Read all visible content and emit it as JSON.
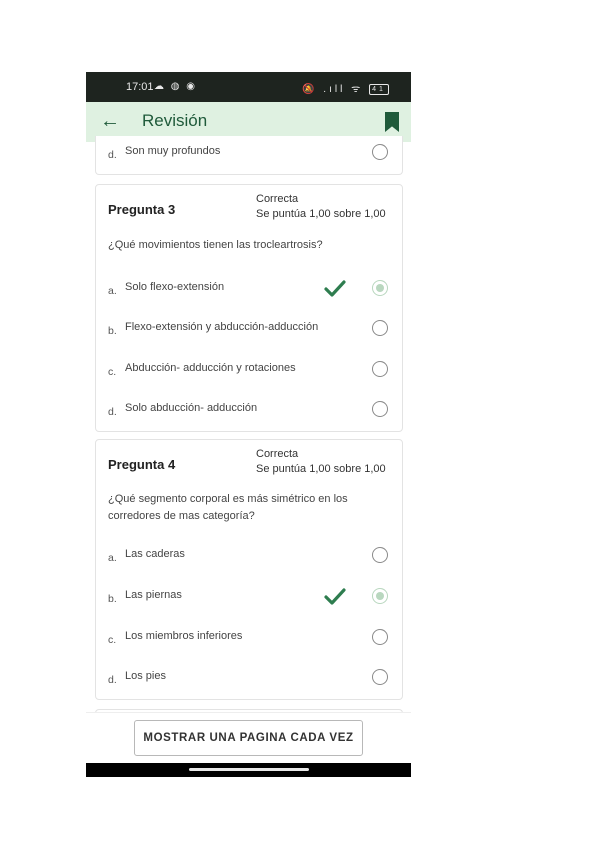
{
  "status_bar": {
    "time": "17:01",
    "left_icons": "☁ ◍ ◉",
    "right_icons": "🔕 .ıll ᯤ",
    "battery": "41"
  },
  "app_bar": {
    "title": "Revisión"
  },
  "previous_card": {
    "letter": "d.",
    "text": "Son muy profundos"
  },
  "questions": [
    {
      "title": "Pregunta 3",
      "state": "Correcta",
      "grade": "Se puntúa 1,00 sobre 1,00",
      "text": "¿Qué movimientos tienen las trocleartrosis?",
      "options": [
        {
          "letter": "a.",
          "text": "Solo flexo-extensión",
          "selected": true,
          "correct": true
        },
        {
          "letter": "b.",
          "text": "Flexo-extensión y abducción-adducción",
          "selected": false
        },
        {
          "letter": "c.",
          "text": "Abducción- adducción y rotaciones",
          "selected": false
        },
        {
          "letter": "d.",
          "text": "Solo abducción- adducción",
          "selected": false
        }
      ]
    },
    {
      "title": "Pregunta 4",
      "state": "Correcta",
      "grade": "Se puntúa 1,00 sobre 1,00",
      "text": "¿Qué segmento corporal es más simétrico en los corredores de mas categoría?",
      "options": [
        {
          "letter": "a.",
          "text": "Las caderas",
          "selected": false
        },
        {
          "letter": "b.",
          "text": "Las piernas",
          "selected": true,
          "correct": true
        },
        {
          "letter": "c.",
          "text": "Los miembros inferiores",
          "selected": false
        },
        {
          "letter": "d.",
          "text": "Los pies",
          "selected": false
        }
      ]
    }
  ],
  "bottom_button": {
    "label": "MOSTRAR UNA PAGINA CADA VEZ"
  },
  "colors": {
    "accent": "#1f5a3a",
    "app_bar_bg": "#dff1e1",
    "check": "#2e7d4f",
    "status_bg": "#1e241f"
  }
}
